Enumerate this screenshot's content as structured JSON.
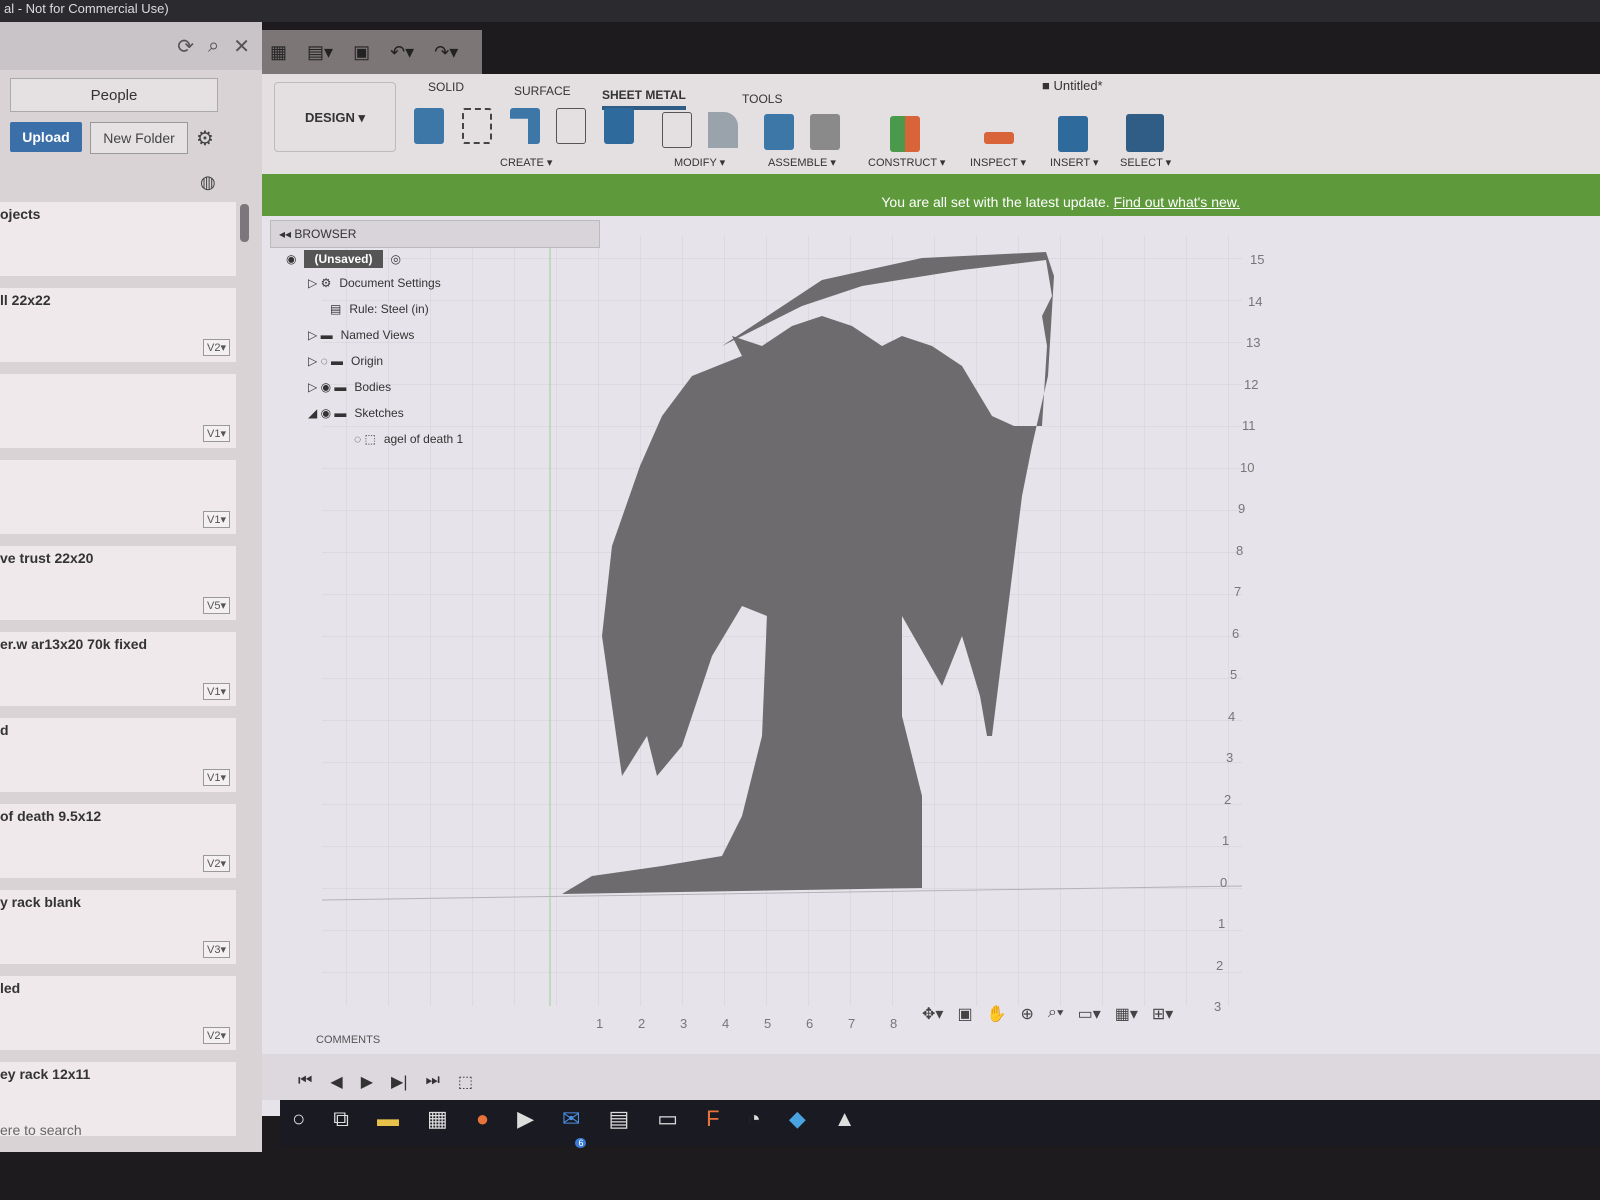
{
  "title": "al - Not for Commercial Use)",
  "left": {
    "people": "People",
    "upload": "Upload",
    "new_folder": "New Folder",
    "search": "ere to search",
    "items": [
      {
        "name": "ojects",
        "version": ""
      },
      {
        "name": "ll 22x22",
        "version": "V2▾"
      },
      {
        "name": "",
        "version": "V1▾"
      },
      {
        "name": "",
        "version": "V1▾"
      },
      {
        "name": "ve trust 22x20",
        "version": "V5▾"
      },
      {
        "name": "er.w ar13x20 70k fixed",
        "version": "V1▾"
      },
      {
        "name": "d",
        "version": "V1▾"
      },
      {
        "name": "of death 9.5x12",
        "version": "V2▾"
      },
      {
        "name": "y rack blank",
        "version": "V3▾"
      },
      {
        "name": "led",
        "version": "V2▾"
      },
      {
        "name": "ey rack 12x11",
        "version": ""
      }
    ]
  },
  "ribbon": {
    "design": "DESIGN ▾",
    "tabs": [
      "SOLID",
      "SURFACE",
      "SHEET METAL",
      "TOOLS"
    ],
    "groups": [
      "CREATE ▾",
      "MODIFY ▾",
      "ASSEMBLE ▾",
      "CONSTRUCT ▾",
      "INSPECT ▾",
      "INSERT ▾",
      "SELECT ▾"
    ],
    "doc_title": "Untitled*"
  },
  "banner": {
    "text": "You are all set with the latest update.",
    "link": "Find out what's new."
  },
  "browser": {
    "title": "BROWSER",
    "nodes": [
      "(Unsaved)",
      "Document Settings",
      "Rule: Steel (in)",
      "Named Views",
      "Origin",
      "Bodies",
      "Sketches",
      "agel of death 1"
    ]
  },
  "axis": {
    "y": [
      "15",
      "14",
      "13",
      "12",
      "11",
      "10",
      "9",
      "8",
      "7",
      "6",
      "5",
      "4",
      "3",
      "2",
      "1",
      "0",
      "1",
      "2",
      "3"
    ],
    "x": [
      "1",
      "2",
      "3",
      "4",
      "5",
      "6",
      "7",
      "8"
    ]
  },
  "comments": "COMMENTS",
  "taskbar": {
    "mail_badge": "6"
  },
  "colors": {
    "banner": "#5e9a3c",
    "accent": "#2f5d86",
    "silhouette": "#6e6b6e"
  }
}
